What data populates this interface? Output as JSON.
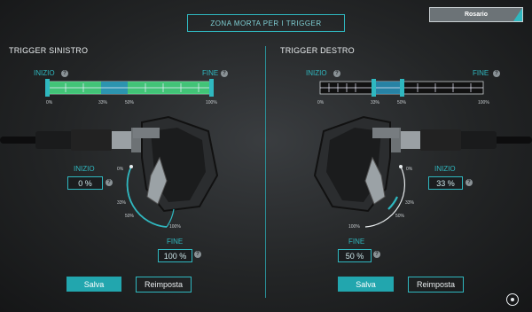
{
  "header": {
    "title": "ZONA MORTA PER I TRIGGER",
    "profile": "Rosario"
  },
  "left": {
    "title": "TRIGGER SINISTRO",
    "start_label": "INIZIO",
    "end_label": "FINE",
    "ticks": [
      "0%",
      "33%",
      "50%",
      "100%"
    ],
    "start_value": "0 %",
    "end_value": "100 %",
    "start_fraction": 0,
    "end_fraction": 1,
    "dial_ticks": [
      "0%",
      "33%",
      "50%",
      "100%"
    ]
  },
  "right": {
    "title": "TRIGGER DESTRO",
    "start_label": "INIZIO",
    "end_label": "FINE",
    "ticks": [
      "0%",
      "33%",
      "50%",
      "100%"
    ],
    "start_value": "33 %",
    "end_value": "50 %",
    "start_fraction": 0.33,
    "end_fraction": 0.5,
    "dial_ticks": [
      "0%",
      "33%",
      "50%",
      "100%"
    ]
  },
  "buttons": {
    "save": "Salva",
    "reset": "Reimposta"
  },
  "colors": {
    "accent": "#2fb8c0",
    "fill_green": "#4be38a",
    "button": "#22a6ae"
  },
  "icons": {
    "help": "help-icon",
    "settings": "circle-settings-icon"
  },
  "help_glyph": "?"
}
